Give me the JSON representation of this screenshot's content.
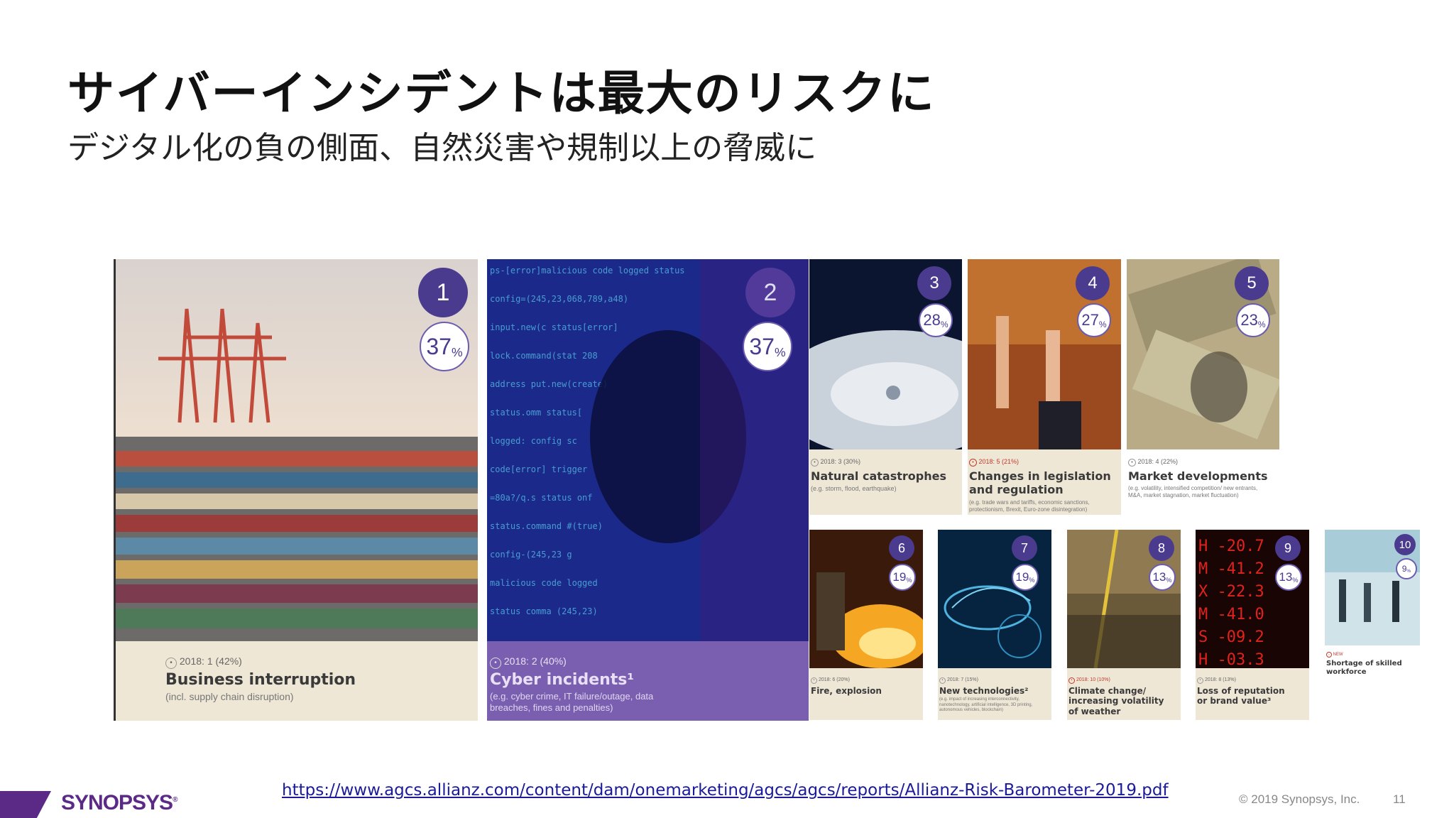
{
  "title": "サイバーインシデントは最大のリスクに",
  "subtitle": "デジタル化の負の側面、自然災害や規制以上の脅威に",
  "risks": [
    {
      "rank": "1",
      "percent": "37",
      "unit": "%",
      "previous": "2018: 1 (42%)",
      "name": "Business interruption",
      "description": "(incl. supply chain disruption)"
    },
    {
      "rank": "2",
      "percent": "37",
      "unit": "%",
      "previous": "2018: 2 (40%)",
      "name": "Cyber incidents¹",
      "description": "(e.g. cyber crime, IT failure/outage, data breaches, fines and penalties)"
    },
    {
      "rank": "3",
      "percent": "28",
      "unit": "%",
      "previous": "2018: 3 (30%)",
      "name": "Natural catastrophes",
      "description": "(e.g. storm, flood, earthquake)"
    },
    {
      "rank": "4",
      "percent": "27",
      "unit": "%",
      "previous": "2018: 5 (21%)",
      "name": "Changes in legislation and regulation",
      "description": "(e.g. trade wars and tariffs, economic sanctions, protectionism, Brexit, Euro-zone disintegration)"
    },
    {
      "rank": "5",
      "percent": "23",
      "unit": "%",
      "previous": "2018: 4 (22%)",
      "name": "Market developments",
      "description": "(e.g. volatility, intensified competition/ new entrants, M&A, market stagnation, market fluctuation)"
    },
    {
      "rank": "6",
      "percent": "19",
      "unit": "%",
      "previous": "2018: 6 (20%)",
      "name": "Fire, explosion",
      "description": ""
    },
    {
      "rank": "7",
      "percent": "19",
      "unit": "%",
      "previous": "2018: 7 (15%)",
      "name": "New technologies²",
      "description": "(e.g. impact of increasing interconnectivity, nanotechnology, artificial intelligence, 3D printing, autonomous vehicles, blockchain)"
    },
    {
      "rank": "8",
      "percent": "13",
      "unit": "%",
      "previous": "2018: 10 (10%)",
      "name": "Climate change/ increasing volatility of weather",
      "description": ""
    },
    {
      "rank": "9",
      "percent": "13",
      "unit": "%",
      "previous": "2018: 8 (13%)",
      "name": "Loss of reputation or brand value³",
      "description": ""
    },
    {
      "rank": "10",
      "percent": "9",
      "unit": "%",
      "previous": "NEW",
      "name": "Shortage of skilled workforce",
      "description": ""
    }
  ],
  "footer": {
    "logo": "SYNOPSYS",
    "logo_mark": "®",
    "source_link": "https://www.agcs.allianz.com/content/dam/onemarketing/agcs/agcs/reports/Allianz-Risk-Barometer-2019.pdf",
    "copyright": "© 2019 Synopsys, Inc.",
    "page_number": "11"
  },
  "colors": {
    "accent_purple": "#4a3b8f",
    "card_beige": "#efe7d6",
    "brand": "#5a2a86"
  }
}
